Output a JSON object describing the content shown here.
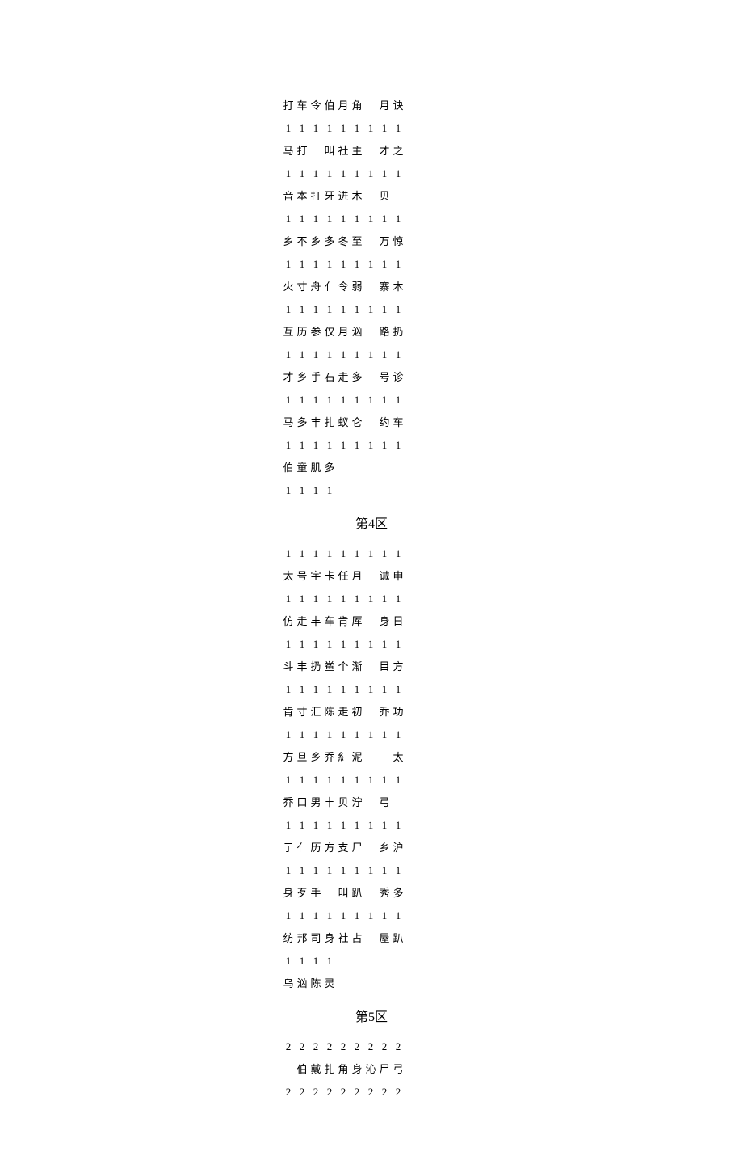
{
  "sections": [
    {
      "title": "",
      "rows": [
        {
          "nums": [
            "1",
            "1",
            "1",
            "1",
            "1",
            "1",
            "1",
            "1",
            "1"
          ],
          "chars": [
            "打",
            "车",
            "令",
            "伯",
            "月",
            "角",
            "",
            "月",
            "诀"
          ],
          "nums_above": false
        },
        {
          "nums": [
            "1",
            "1",
            "1",
            "1",
            "1",
            "1",
            "1",
            "1",
            "1"
          ],
          "chars": [
            "马",
            "打",
            "",
            "叫",
            "社",
            "主",
            "",
            "才",
            "之"
          ]
        },
        {
          "nums": [
            "1",
            "1",
            "1",
            "1",
            "1",
            "1",
            "1",
            "1",
            "1"
          ],
          "chars": [
            "音",
            "本",
            "打",
            "牙",
            "进",
            "木",
            "",
            "贝",
            ""
          ]
        },
        {
          "nums": [
            "1",
            "1",
            "1",
            "1",
            "1",
            "1",
            "1",
            "1",
            "1"
          ],
          "chars": [
            "乡",
            "不",
            "乡",
            "多",
            "冬",
            "至",
            "",
            "万",
            "惊"
          ]
        },
        {
          "nums": [
            "1",
            "1",
            "1",
            "1",
            "1",
            "1",
            "1",
            "1",
            "1"
          ],
          "chars": [
            "火",
            "寸",
            "舟",
            "亻",
            "令",
            "弱",
            "",
            "寨",
            "木"
          ]
        },
        {
          "nums": [
            "1",
            "1",
            "1",
            "1",
            "1",
            "1",
            "1",
            "1",
            "1"
          ],
          "chars": [
            "互",
            "历",
            "参",
            "仅",
            "月",
            "汹",
            "",
            "路",
            "扔"
          ]
        },
        {
          "nums": [
            "1",
            "1",
            "1",
            "1",
            "1",
            "1",
            "1",
            "1",
            "1"
          ],
          "chars": [
            "才",
            "乡",
            "手",
            "石",
            "走",
            "多",
            "",
            "号",
            "诊"
          ]
        },
        {
          "nums": [
            "1",
            "1",
            "1",
            "1",
            "1",
            "1",
            "1",
            "1",
            "1"
          ],
          "chars": [
            "马",
            "多",
            "丰",
            "扎",
            "蚁",
            "仑",
            "",
            "约",
            "车"
          ]
        },
        {
          "nums": [
            "1",
            "1",
            "1",
            "1",
            "",
            "",
            "",
            "",
            ""
          ],
          "chars": [
            "伯",
            "童",
            "肌",
            "多",
            "",
            "",
            "",
            "",
            ""
          ]
        }
      ]
    },
    {
      "title": "第4区",
      "rows": [
        {
          "nums": [
            "1",
            "1",
            "1",
            "1",
            "1",
            "1",
            "1",
            "1",
            "1"
          ],
          "chars": [
            "太",
            "号",
            "宇",
            "卡",
            "任",
            "月",
            "",
            "诫",
            "申"
          ]
        },
        {
          "nums": [
            "1",
            "1",
            "1",
            "1",
            "1",
            "1",
            "1",
            "1",
            "1"
          ],
          "chars": [
            "仿",
            "走",
            "丰",
            "车",
            "肯",
            "厍",
            "",
            "身",
            "日"
          ]
        },
        {
          "nums": [
            "1",
            "1",
            "1",
            "1",
            "1",
            "1",
            "1",
            "1",
            "1"
          ],
          "chars": [
            "斗",
            "丰",
            "扔",
            "鲎",
            "个",
            "渐",
            "",
            "目",
            "方"
          ]
        },
        {
          "nums": [
            "1",
            "1",
            "1",
            "1",
            "1",
            "1",
            "1",
            "1",
            "1"
          ],
          "chars": [
            "肯",
            "寸",
            "汇",
            "陈",
            "走",
            "初",
            "",
            "乔",
            "功"
          ]
        },
        {
          "nums": [
            "1",
            "1",
            "1",
            "1",
            "1",
            "1",
            "1",
            "1",
            "1"
          ],
          "chars": [
            "方",
            "旦",
            "乡",
            "乔",
            "糹",
            "泥",
            "",
            "",
            "太"
          ]
        },
        {
          "nums": [
            "1",
            "1",
            "1",
            "1",
            "1",
            "1",
            "1",
            "1",
            "1"
          ],
          "chars": [
            "乔",
            "口",
            "男",
            "丰",
            "贝",
            "泞",
            "",
            "弓",
            ""
          ]
        },
        {
          "nums": [
            "1",
            "1",
            "1",
            "1",
            "1",
            "1",
            "1",
            "1",
            "1"
          ],
          "chars": [
            "亍",
            "亻",
            "历",
            "方",
            "支",
            "尸",
            "",
            "乡",
            "沪"
          ]
        },
        {
          "nums": [
            "1",
            "1",
            "1",
            "1",
            "1",
            "1",
            "1",
            "1",
            "1"
          ],
          "chars": [
            "身",
            "歹",
            "手",
            "",
            "叫",
            "趴",
            "",
            "秀",
            "多"
          ]
        },
        {
          "nums": [
            "1",
            "1",
            "1",
            "1",
            "1",
            "1",
            "1",
            "1",
            "1"
          ],
          "chars": [
            "纺",
            "邦",
            "司",
            "身",
            "社",
            "占",
            "",
            "屋",
            "趴"
          ]
        },
        {
          "nums": [
            "1",
            "1",
            "1",
            "1",
            "",
            "",
            "",
            "",
            ""
          ],
          "chars": [
            "乌",
            "汹",
            "陈",
            "灵",
            "",
            "",
            "",
            "",
            ""
          ]
        }
      ]
    },
    {
      "title": "第5区",
      "rows": [
        {
          "nums": [
            "2",
            "2",
            "2",
            "2",
            "2",
            "2",
            "2",
            "2",
            "2"
          ],
          "chars": [
            "",
            "伯",
            "戴",
            "扎",
            "角",
            "身",
            "沁",
            "尸",
            "弓"
          ]
        },
        {
          "nums": [
            "2",
            "2",
            "2",
            "2",
            "2",
            "2",
            "2",
            "2",
            "2"
          ],
          "chars": [
            "",
            "",
            "",
            "",
            "",
            "",
            "",
            "",
            ""
          ]
        }
      ]
    }
  ]
}
